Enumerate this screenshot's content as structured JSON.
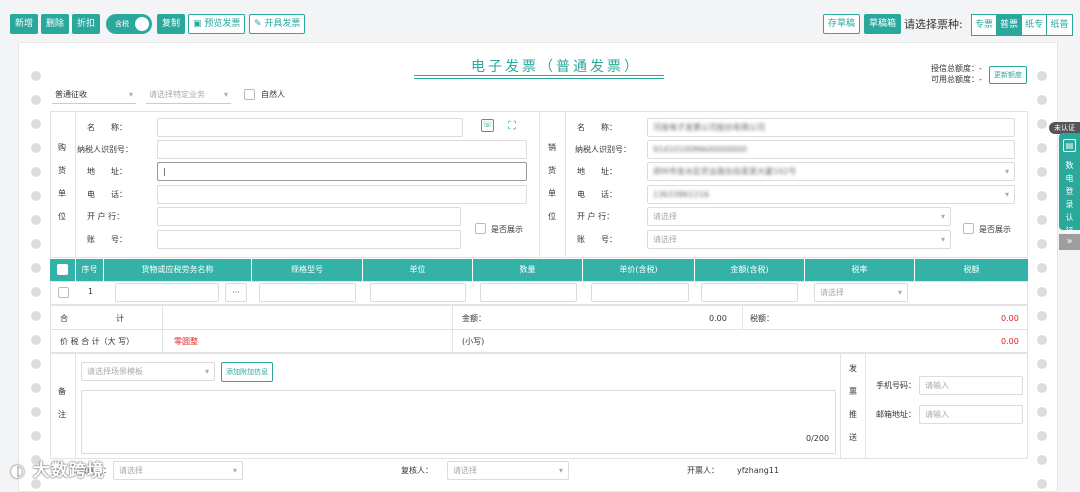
{
  "toolbar": {
    "add": "新增",
    "delete": "删除",
    "discount": "折扣",
    "tax_toggle": "含税",
    "copy": "复制",
    "preview": "预览发票",
    "issue": "开具发票",
    "save_draft": "存草稿",
    "draft_box": "草稿箱",
    "ticket_type_label": "请选择票种:",
    "ticket_types": [
      "专票",
      "普票",
      "纸专",
      "纸普"
    ],
    "ticket_type_selected": "普票"
  },
  "invoice": {
    "title": "电子发票（普通发票）",
    "credit_total_label": "授信总额度：-",
    "available_total_label": "可用总额度：-",
    "update_quota": "更新额度",
    "tax_mode": "普通征收",
    "special_business_placeholder": "请选择特定业务",
    "natural_person": "自然人"
  },
  "buyer": {
    "section": [
      "购",
      "货",
      "单",
      "位"
    ],
    "name_label": "名　　称：",
    "tax_id_label": "纳税人识别号：",
    "address_label": "地　　址：",
    "phone_label": "电　　话：",
    "bank_label": "开 户 行：",
    "account_label": "账　　号：",
    "show_label": "是否展示"
  },
  "seller": {
    "section": [
      "销",
      "货",
      "单",
      "位"
    ],
    "name_label": "名　　称：",
    "tax_id_label": "纳税人识别号：",
    "address_label": "地　　址：",
    "phone_label": "电　　话：",
    "bank_label": "开 户 行：",
    "account_label": "账　　号：",
    "name_value": "河南电子发票公司股份有限公司",
    "tax_id_value": "91410100MA00000000",
    "address_value": "郑州市金水区农业路东段某某大厦102号",
    "phone_value": "13633861216",
    "bank_placeholder": "请选择",
    "account_placeholder": "请选择",
    "show_label": "是否展示"
  },
  "items_table": {
    "headers": [
      "序号",
      "货物或应税劳务名称",
      "规格型号",
      "单位",
      "数量",
      "单价(含税)",
      "金额(含税)",
      "税率",
      "税额"
    ],
    "rows": [
      {
        "index": "1",
        "more": "···",
        "tax_rate_placeholder": "请选择"
      }
    ]
  },
  "totals": {
    "total_label": "合　　　　　　计",
    "amount_label": "金额：",
    "amount_value": "0.00",
    "tax_label": "税额：",
    "tax_value": "0.00",
    "grand_label": "价 税 合 计（大 写）",
    "grand_upper": "零圆整",
    "grand_lower_label": "(小写)",
    "grand_lower_value": "0.00"
  },
  "remarks": {
    "section": [
      "备",
      "注"
    ],
    "scene_placeholder": "请选择场景模板",
    "add_info": "添加附加信息",
    "counter": "0/200"
  },
  "push": {
    "section": [
      "发",
      "票",
      "推",
      "送"
    ],
    "phone_label": "手机号码：",
    "phone_placeholder": "请输入",
    "email_label": "邮箱地址：",
    "email_placeholder": "请输入"
  },
  "footer": {
    "payee_label": "收款人：",
    "payee_placeholder": "请选择",
    "reviewer_label": "复核人：",
    "reviewer_placeholder": "请选择",
    "drawer_label": "开票人：",
    "drawer_value": "yfzhang11"
  },
  "side_panel": {
    "status": "未认证",
    "label": [
      "数",
      "电",
      "登",
      "录",
      "认",
      "证"
    ],
    "collapse": "»"
  },
  "watermark": "大数跨境"
}
